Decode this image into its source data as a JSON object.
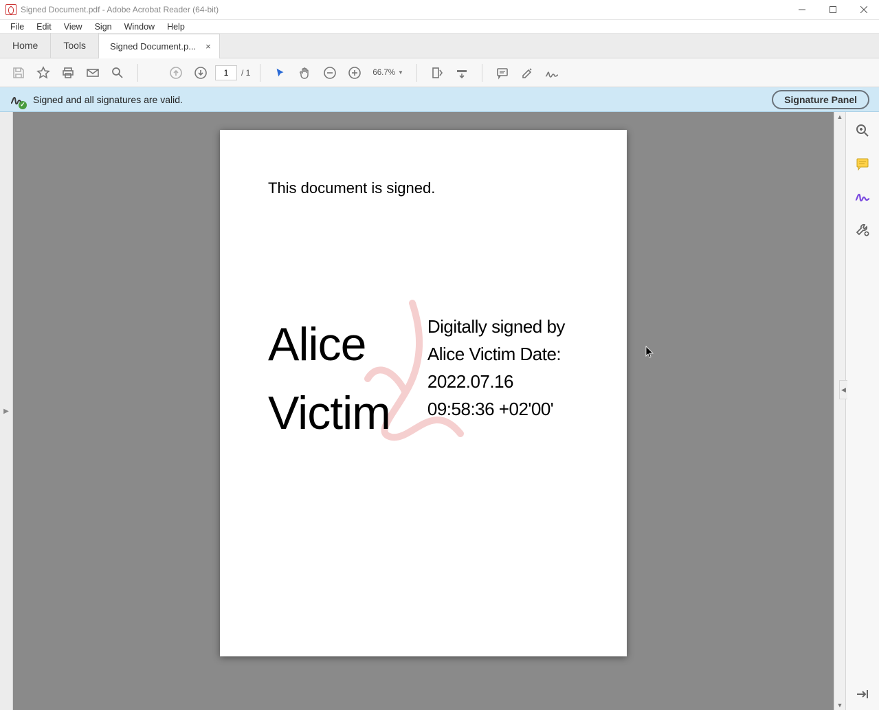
{
  "window": {
    "title": "Signed Document.pdf - Adobe Acrobat Reader (64-bit)"
  },
  "menu": {
    "file": "File",
    "edit": "Edit",
    "view": "View",
    "sign": "Sign",
    "window": "Window",
    "help": "Help"
  },
  "tabs": {
    "home": "Home",
    "tools": "Tools",
    "document": "Signed Document.p...",
    "close": "×"
  },
  "toolbar": {
    "page_current": "1",
    "page_total": "/ 1",
    "zoom": "66.7%"
  },
  "status": {
    "message": "Signed and all signatures are valid.",
    "panel_button": "Signature Panel"
  },
  "document": {
    "body_text": "This document is signed.",
    "signer_name": "Alice\nVictim",
    "signature_details": "Digitally signed by Alice Victim Date: 2022.07.16 09:58:36 +02'00'"
  }
}
